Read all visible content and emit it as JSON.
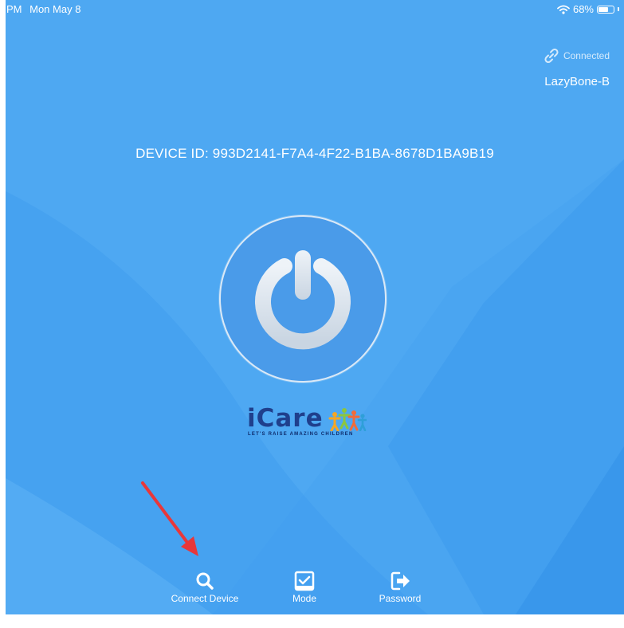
{
  "status_bar": {
    "time_fragment": "PM",
    "date": "Mon May 8",
    "battery_percent_label": "68%",
    "battery_level": 0.68,
    "icons": [
      "wifi-icon",
      "battery-icon"
    ]
  },
  "connection": {
    "status": "Connected",
    "device_name": "LazyBone-B",
    "icon": "link-icon"
  },
  "device_id": "DEVICE ID: 993D2141-F7A4-4F22-B1BA-8678D1BA9B19",
  "power_button": {
    "icon": "power-icon"
  },
  "logo": {
    "name": "iCare",
    "tagline": "LET'S RAISE AMAZING CHILDREN"
  },
  "toolbar": {
    "items": [
      {
        "label": "Connect Device",
        "icon": "search-icon"
      },
      {
        "label": "Mode",
        "icon": "checkbox-icon"
      },
      {
        "label": "Password",
        "icon": "sign-out-icon"
      }
    ]
  },
  "annotation": {
    "icon": "red-arrow-icon"
  },
  "colors": {
    "background": "#4aa5f1",
    "background_light": "#5db0f4",
    "background_dark": "#2f8ee8",
    "power_button": "#4a9be9",
    "power_ring": "#dbe9f6",
    "logo_text": "#1f3f8c",
    "arrow": "#e8373a"
  }
}
